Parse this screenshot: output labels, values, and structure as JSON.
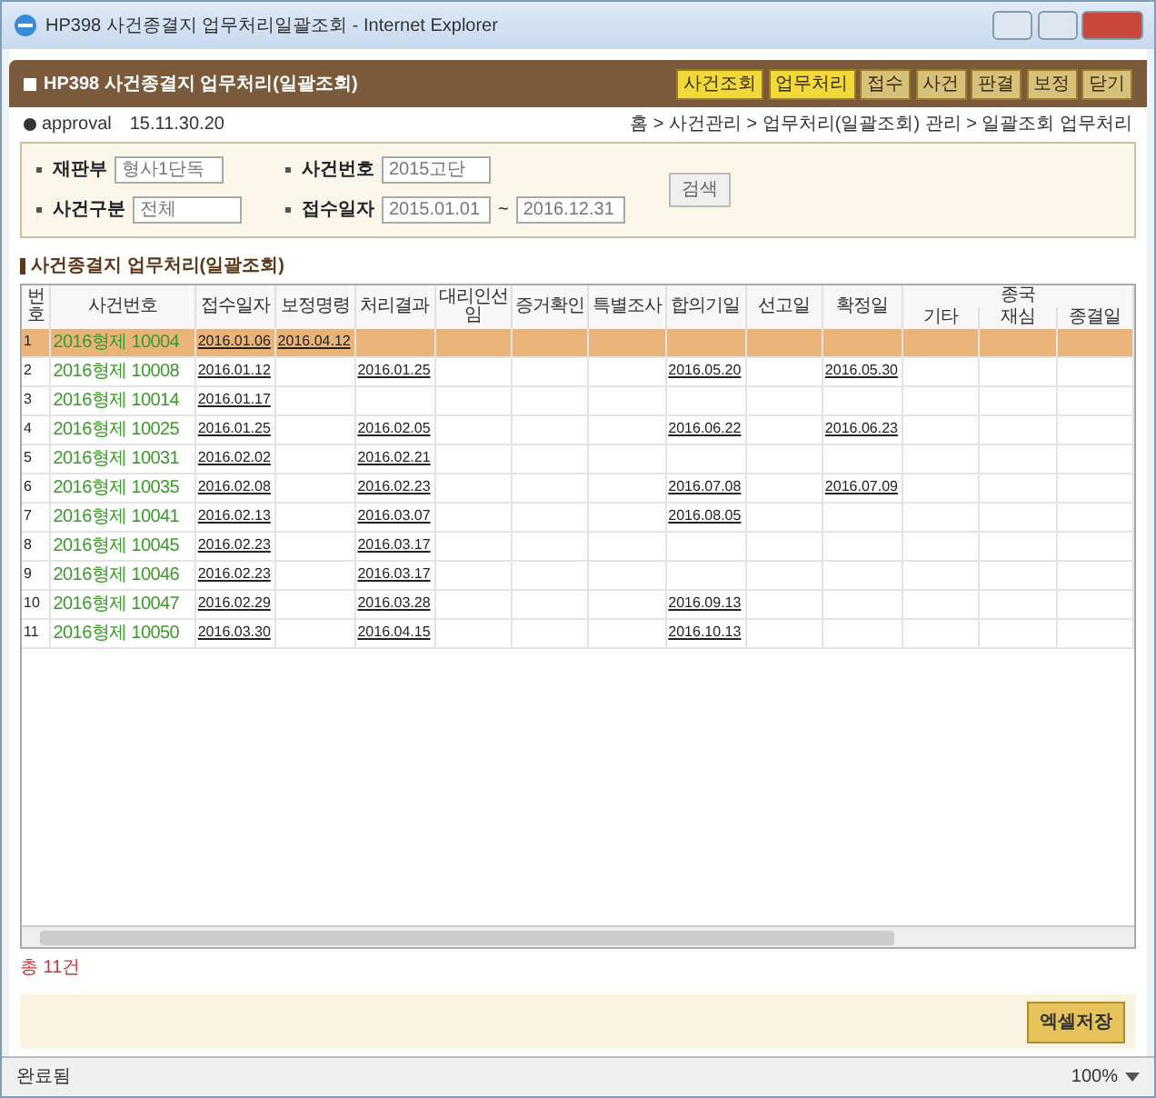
{
  "window": {
    "title": "HP398 사건종결지 업무처리일괄조회 - Internet Explorer"
  },
  "header": {
    "title": "HP398 사건종결지 업무처리(일괄조회)",
    "buttons": [
      {
        "label": "사건조회",
        "selected": true
      },
      {
        "label": "업무처리",
        "selected": true
      },
      {
        "label": "접수",
        "selected": false
      },
      {
        "label": "사건",
        "selected": false
      },
      {
        "label": "판결",
        "selected": false
      },
      {
        "label": "보정",
        "selected": false
      },
      {
        "label": "닫기",
        "selected": false
      }
    ]
  },
  "info": {
    "user": "approval",
    "ip": "15.11.30.20",
    "breadcrumb": "홈 > 사건관리 > 업무처리(일괄조회) 관리 > 일괄조회 업무처리"
  },
  "search": {
    "fields": [
      {
        "label": "재판부",
        "value": "형사1단독"
      },
      {
        "label": "사건번호",
        "value": "2015고단"
      },
      {
        "label": "사건구분",
        "value": "전체"
      },
      {
        "label": "접수일자",
        "from": "2015.01.01",
        "separator": "~",
        "to": "2016.12.31"
      }
    ],
    "button": "검색"
  },
  "section_title": "사건종결지 업무처리(일괄조회)",
  "table": {
    "columns": [
      "번호",
      "사건번호",
      "접수일자",
      "보정명령",
      "처리결과",
      "대리인선임",
      "증거확인",
      "특별조사",
      "합의기일",
      "선고일",
      "확정일"
    ],
    "group": {
      "label": "종국",
      "columns": [
        "기타",
        "재심",
        "종결일"
      ]
    },
    "rows": [
      {
        "selected": true,
        "cells": [
          "1",
          "2016형제 10004",
          "2016.01.06",
          "2016.04.12",
          null,
          null,
          null,
          null,
          null,
          null,
          null,
          null,
          null,
          null
        ]
      },
      {
        "selected": false,
        "cells": [
          "2",
          "2016형제 10008",
          "2016.01.12",
          null,
          "2016.01.25",
          null,
          null,
          null,
          "2016.05.20",
          null,
          "2016.05.30",
          null,
          null,
          null
        ]
      },
      {
        "selected": false,
        "cells": [
          "3",
          "2016형제 10014",
          "2016.01.17",
          null,
          null,
          null,
          null,
          null,
          null,
          null,
          null,
          null,
          null,
          null
        ]
      },
      {
        "selected": false,
        "cells": [
          "4",
          "2016형제 10025",
          "2016.01.25",
          null,
          "2016.02.05",
          null,
          null,
          null,
          "2016.06.22",
          null,
          "2016.06.23",
          null,
          null,
          null
        ]
      },
      {
        "selected": false,
        "cells": [
          "5",
          "2016형제 10031",
          "2016.02.02",
          null,
          "2016.02.21",
          null,
          null,
          null,
          null,
          null,
          null,
          null,
          null,
          null
        ]
      },
      {
        "selected": false,
        "cells": [
          "6",
          "2016형제 10035",
          "2016.02.08",
          null,
          "2016.02.23",
          null,
          null,
          null,
          "2016.07.08",
          null,
          "2016.07.09",
          null,
          null,
          null
        ]
      },
      {
        "selected": false,
        "cells": [
          "7",
          "2016형제 10041",
          "2016.02.13",
          null,
          "2016.03.07",
          null,
          null,
          null,
          "2016.08.05",
          null,
          null,
          null,
          null,
          null
        ]
      },
      {
        "selected": false,
        "cells": [
          "8",
          "2016형제 10045",
          "2016.02.23",
          null,
          "2016.03.17",
          null,
          null,
          null,
          null,
          null,
          null,
          null,
          null,
          null
        ]
      },
      {
        "selected": false,
        "cells": [
          "9",
          "2016형제 10046",
          "2016.02.23",
          null,
          "2016.03.17",
          null,
          null,
          null,
          null,
          null,
          null,
          null,
          null,
          null
        ]
      },
      {
        "selected": false,
        "cells": [
          "10",
          "2016형제 10047",
          "2016.02.29",
          null,
          "2016.03.28",
          null,
          null,
          null,
          "2016.09.13",
          null,
          null,
          null,
          null,
          null
        ]
      },
      {
        "selected": false,
        "cells": [
          "11",
          "2016형제 10050",
          "2016.03.30",
          null,
          "2016.04.15",
          null,
          null,
          null,
          "2016.10.13",
          null,
          null,
          null,
          null,
          null
        ]
      }
    ]
  },
  "count": "총 11건",
  "footer_button": "엑셀저장",
  "status_bar": {
    "text": "완료됨",
    "zoom": "100%"
  }
}
